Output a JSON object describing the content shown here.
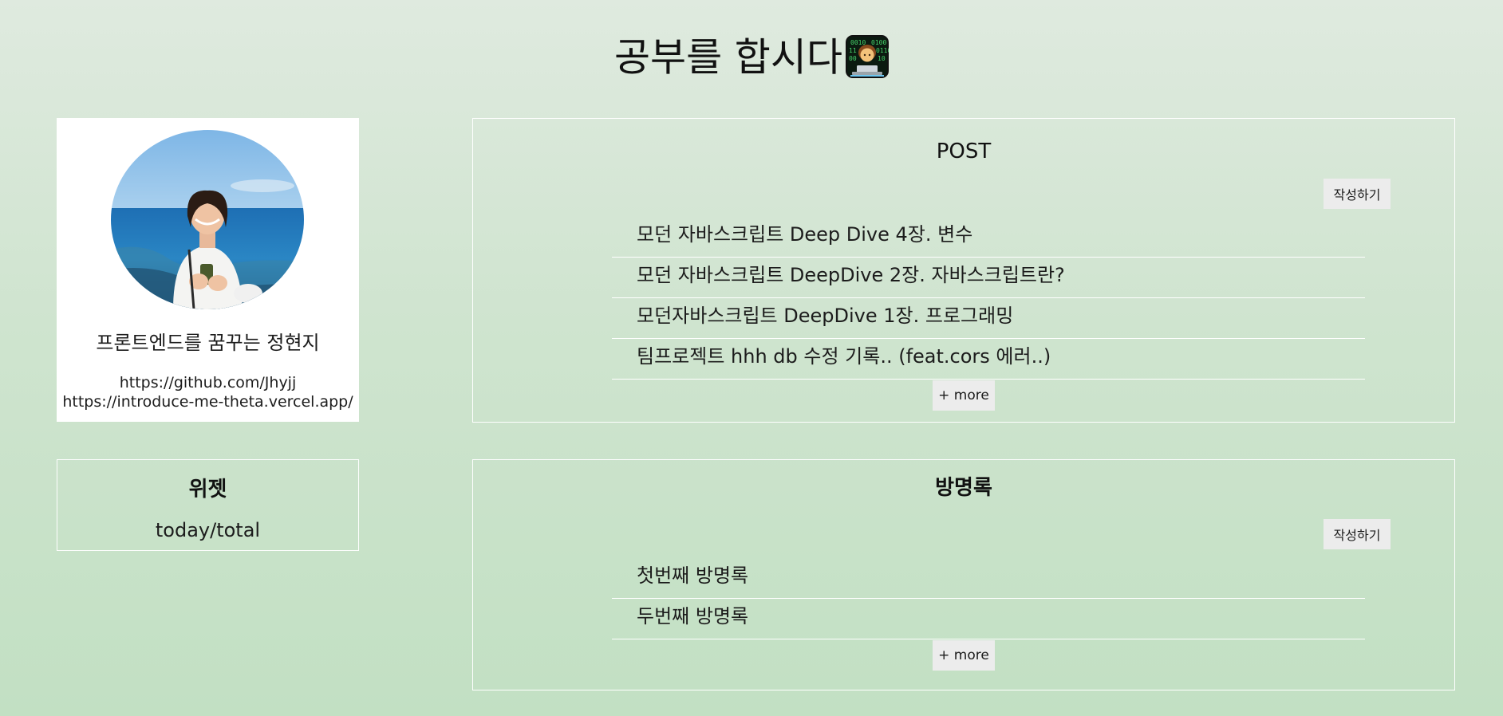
{
  "header": {
    "title": "공부를 합시다",
    "title_icon": "technologist-emoji-icon"
  },
  "profile": {
    "name": "프론트엔드를 꿈꾸는 정현지",
    "links": [
      "https://github.com/Jhyjj",
      "https://introduce-me-theta.vercel.app/"
    ]
  },
  "widget": {
    "title": "위젯",
    "counter": "today/total"
  },
  "posts": {
    "title": "POST",
    "write_label": "작성하기",
    "items": [
      "모던 자바스크립트 Deep Dive 4장. 변수",
      "모던 자바스크립트 DeepDive 2장. 자바스크립트란?",
      "모던자바스크립트 DeepDive 1장. 프로그래밍",
      "팀프로젝트 hhh db 수정 기록.. (feat.cors 에러..)"
    ],
    "more_label": "+ more"
  },
  "guestbook": {
    "title": "방명록",
    "write_label": "작성하기",
    "items": [
      "첫번째 방명록",
      "두번째 방명록"
    ],
    "more_label": "+ more"
  },
  "colors": {
    "background_top": "#dfeadf",
    "background_bottom": "#c2e0c3",
    "card": "#ffffff",
    "button": "#ececec"
  }
}
